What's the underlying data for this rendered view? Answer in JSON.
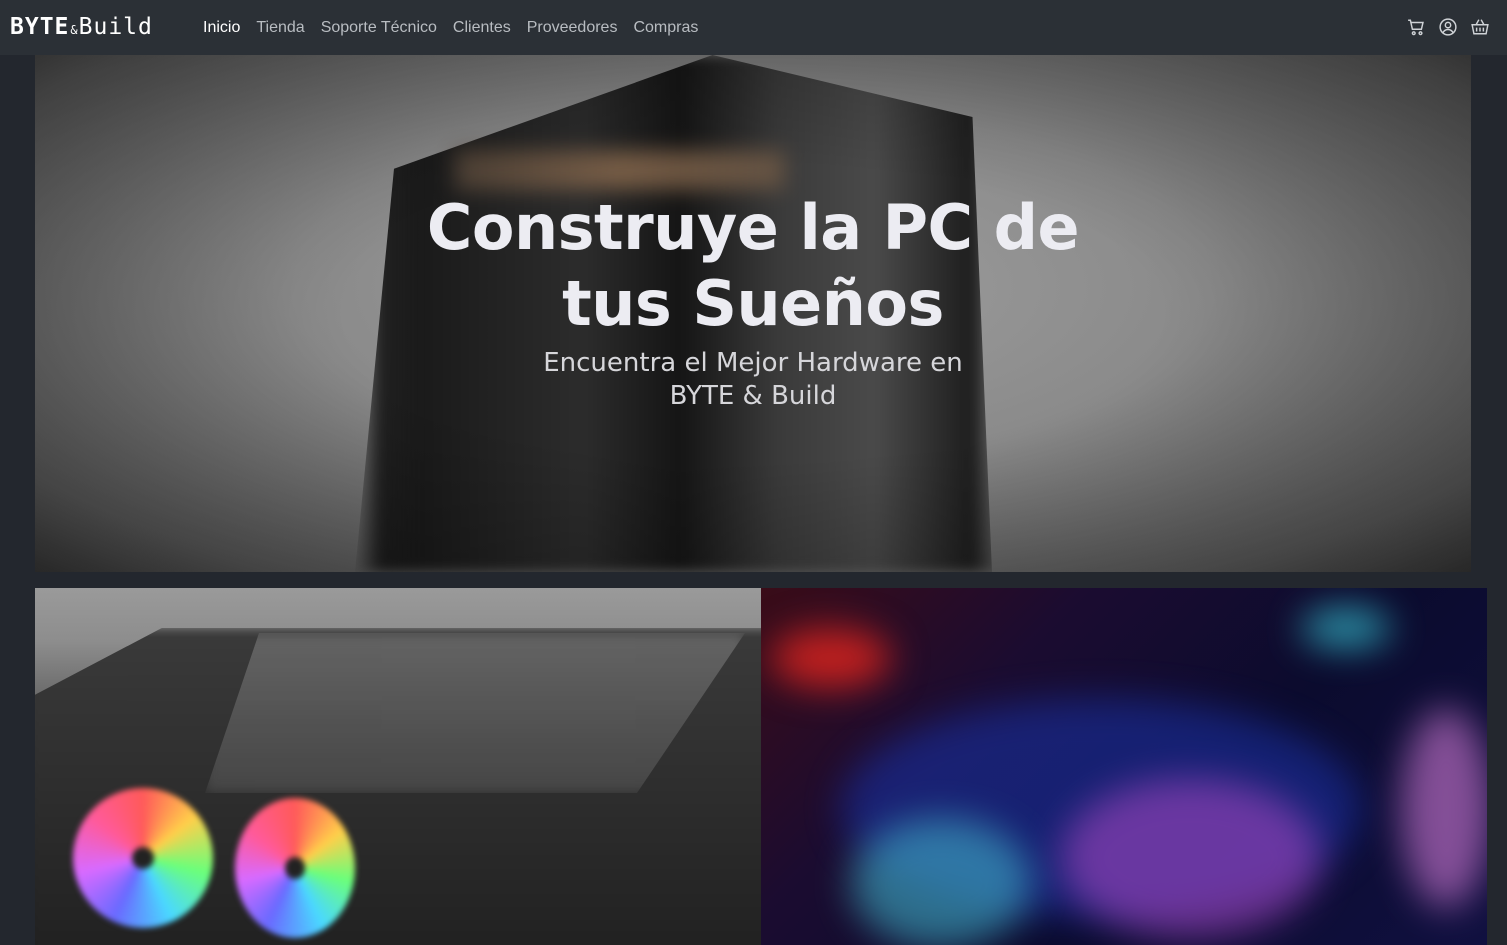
{
  "brand": {
    "part1": "BYTE",
    "amp": "&",
    "part2": "Build"
  },
  "nav": {
    "links": [
      "Inicio",
      "Tienda",
      "Soporte Técnico",
      "Clientes",
      "Proveedores",
      "Compras"
    ],
    "active": "Inicio",
    "icons": [
      "cart-icon",
      "user-icon",
      "basket-icon"
    ]
  },
  "hero": {
    "title_line1": "Construye la PC de",
    "title_line2": "tus Sueños",
    "subtitle_line1": "Encuentra el Mejor Hardware en",
    "subtitle_line2": "BYTE & Build"
  },
  "colors": {
    "navbar": "#2b3036",
    "page": "#23272e",
    "active_link": "#ffffff",
    "link": "#b8bcc1"
  }
}
